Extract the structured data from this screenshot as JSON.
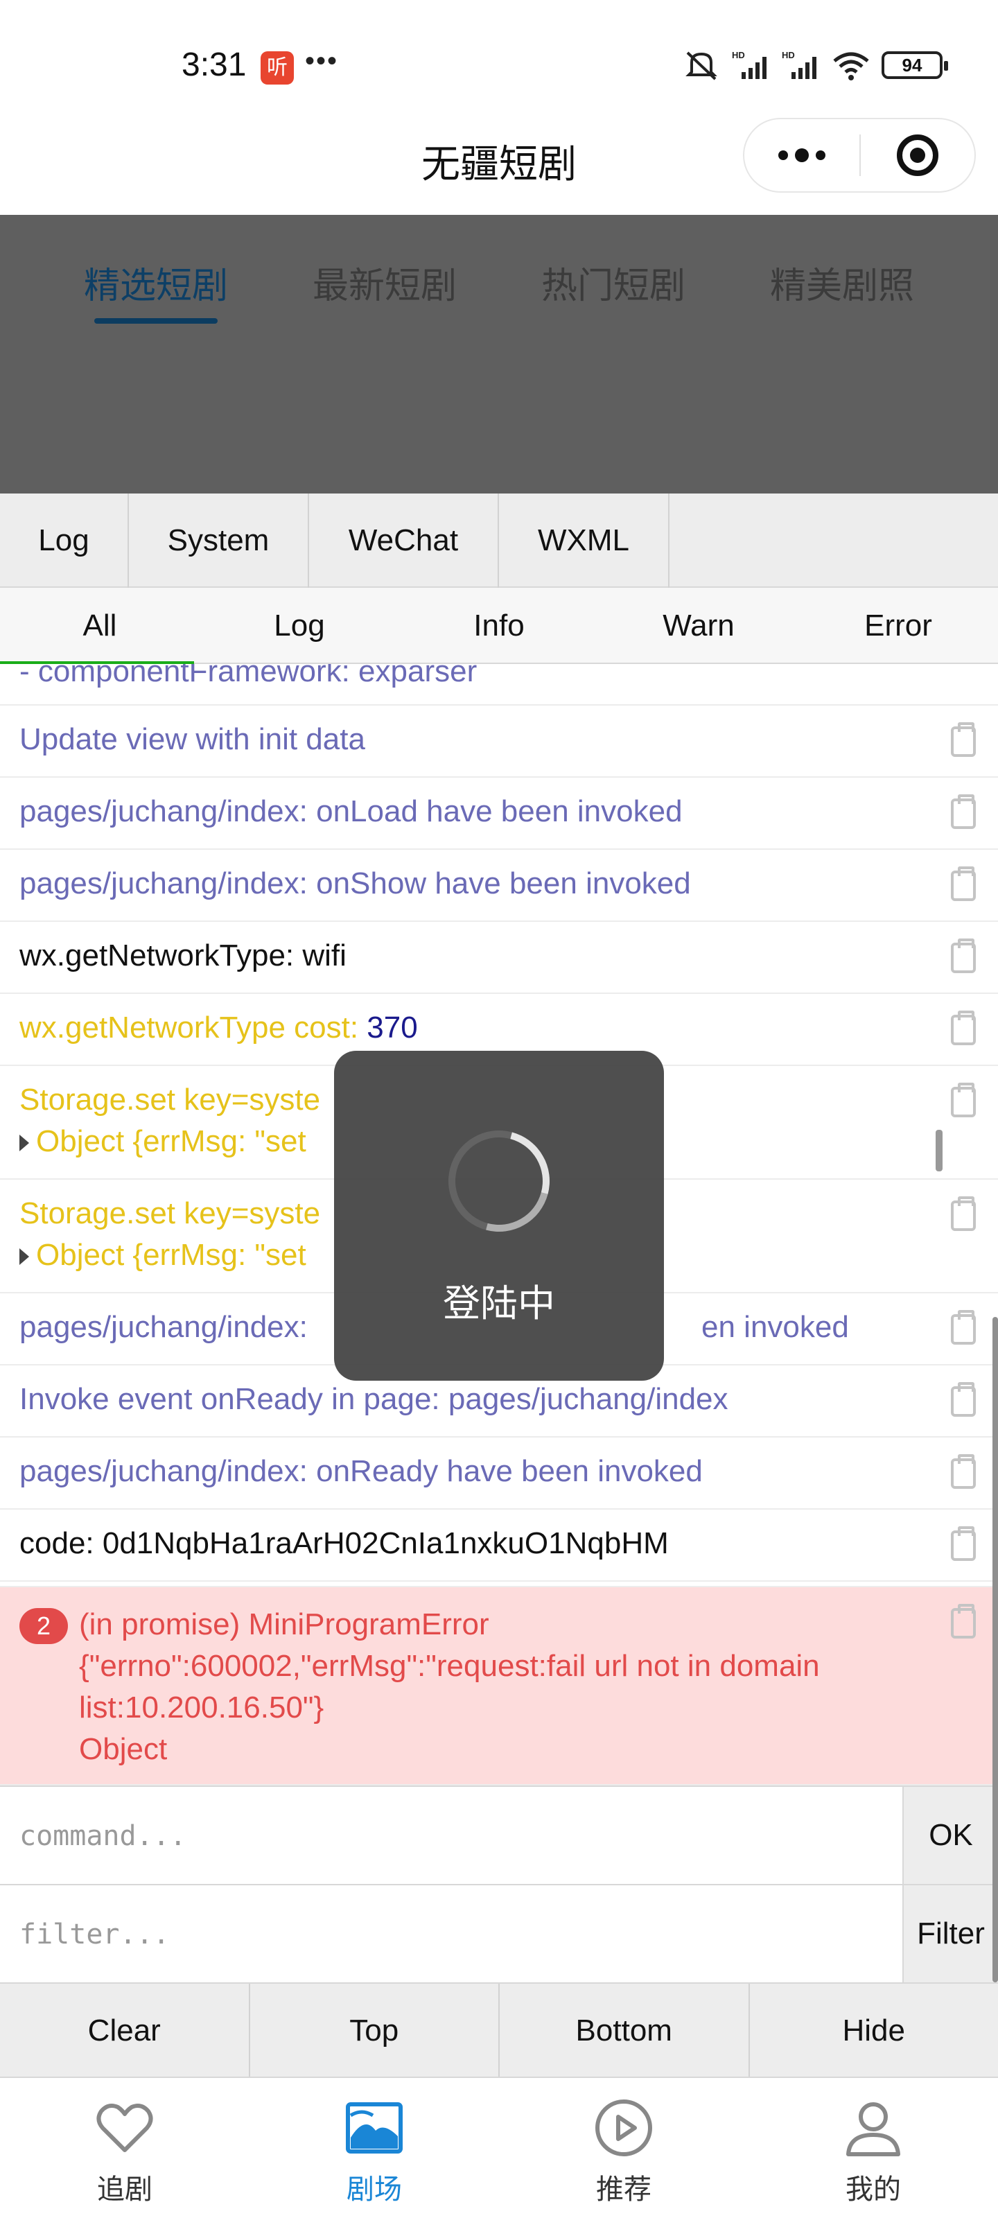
{
  "status_bar": {
    "time": "3:31",
    "app_badge": "听",
    "battery": "94"
  },
  "title_bar": {
    "title": "无疆短剧"
  },
  "page_tabs": [
    "精选短剧",
    "最新短剧",
    "热门短剧",
    "精美剧照"
  ],
  "vconsole": {
    "tabs": [
      "Log",
      "System",
      "WeChat",
      "WXML"
    ],
    "subtabs": [
      "All",
      "Log",
      "Info",
      "Warn",
      "Error"
    ],
    "logs": {
      "r0": "- componentFramework: exparser",
      "r1": "Update view with init data",
      "r2": "pages/juchang/index: onLoad have been invoked",
      "r3": "pages/juchang/index: onShow have been invoked",
      "r4": "wx.getNetworkType: wifi",
      "r5_prefix": "wx.getNetworkType cost: ",
      "r5_value": "370",
      "r6_line1": "Storage.set key=syste",
      "r6_line2": "Object {errMsg: \"set",
      "r7_line1": "Storage.set key=syste",
      "r7_line2": "Object {errMsg: \"set",
      "r8_left": "pages/juchang/index:",
      "r8_right": "en invoked",
      "r9": "Invoke event onReady in page: pages/juchang/index",
      "r10": "pages/juchang/index: onReady have been invoked",
      "r11": "code:  0d1NqbHa1raArH02CnIa1nxkuO1NqbHM"
    },
    "error": {
      "count": "2",
      "line1": "(in promise) MiniProgramError",
      "line2": "{\"errno\":600002,\"errMsg\":\"request:fail url not in domain",
      "line3": "list:10.200.16.50\"}",
      "line4": "Object"
    },
    "command_placeholder": "command...",
    "ok_label": "OK",
    "filter_placeholder": "filter...",
    "filter_label": "Filter",
    "toolbar": [
      "Clear",
      "Top",
      "Bottom",
      "Hide"
    ]
  },
  "toast": {
    "text": "登陆中"
  },
  "tab_bar": {
    "items": [
      {
        "label": "追剧",
        "icon": "heart-icon"
      },
      {
        "label": "剧场",
        "icon": "picture-icon"
      },
      {
        "label": "推荐",
        "icon": "play-icon"
      },
      {
        "label": "我的",
        "icon": "user-icon"
      }
    ],
    "active_color": "#1a86d6"
  }
}
